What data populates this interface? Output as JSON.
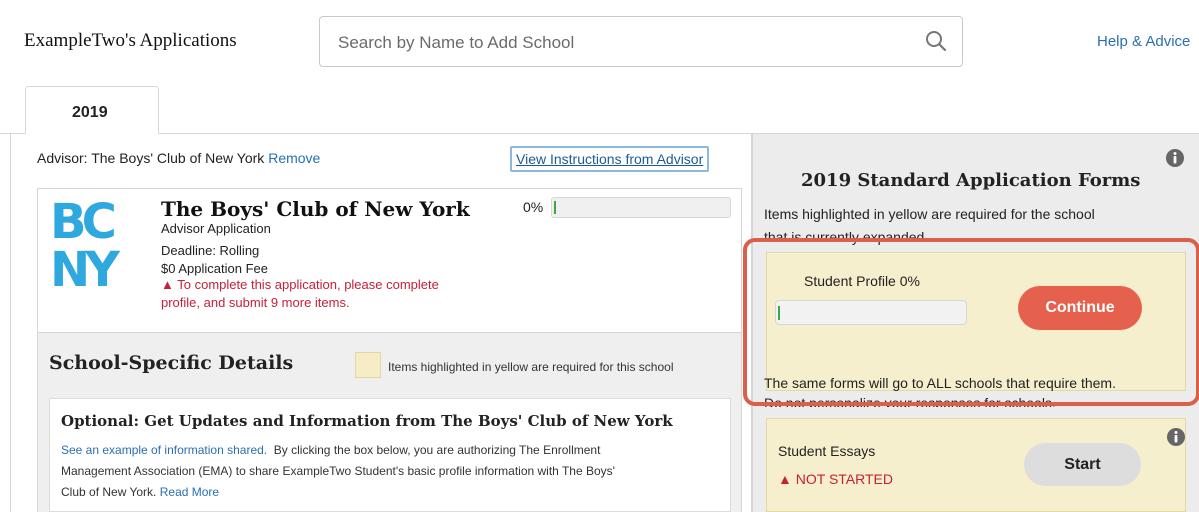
{
  "header": {
    "title": "ExampleTwo's Applications",
    "search_placeholder": "Search by Name to Add School",
    "help_link": "Help & Advice"
  },
  "tabs": [
    {
      "label": "2019",
      "active": true
    }
  ],
  "advisor": {
    "label": "Advisor: The Boys' Club of New York",
    "remove": "Remove",
    "view_instructions": "View Instructions from Advisor"
  },
  "school": {
    "logo_text": [
      "BC",
      "NY"
    ],
    "name": "The Boys' Club of New York",
    "meta": [
      "Advisor Application",
      "Deadline: Rolling",
      "$0 Application Fee"
    ],
    "warning_line1": "To complete this application, please complete",
    "warning_line2": "profile, and submit 9 more items.",
    "progress_label": "0%",
    "progress_value": 0
  },
  "details": {
    "title": "School-Specific Details",
    "legend": "Items highlighted in yellow are required for this school",
    "optional_title": "Optional: Get Updates and Information from The Boys' Club of New York",
    "optional_link": "See an example of information shared.",
    "optional_text_1": "By clicking the box below, you are authorizing The Enrollment",
    "optional_text_2": "Management Association (EMA) to share ExampleTwo Student's basic profile information with The Boys'",
    "optional_text_3": "Club of New York.",
    "read_more": "Read More"
  },
  "forms": {
    "title": "2019 Standard Application Forms",
    "desc_line1": "Items highlighted in yellow are required for the school",
    "desc_line2": "that is currently expanded.",
    "profile": {
      "label": "Student Profile 0%",
      "progress_value": 0,
      "button": "Continue"
    },
    "same_line1": "The same forms will go to ALL schools that require them.",
    "same_line2": "Do not personalize your responses for schools.",
    "essays": {
      "label": "Student Essays",
      "status": "NOT STARTED",
      "button": "Start"
    }
  },
  "colors": {
    "link": "#2a6fb3",
    "accent_button": "#e5614e",
    "warning": "#c62038",
    "highlight_yellow": "#f6efcd",
    "logo_blue": "#2fa8e0"
  }
}
